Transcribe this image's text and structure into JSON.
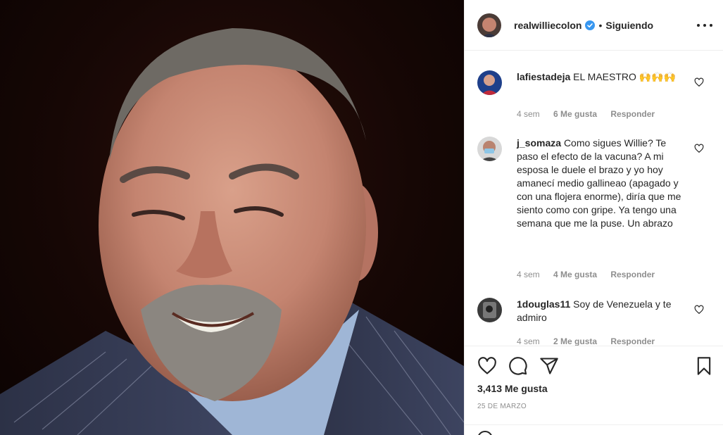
{
  "post": {
    "username": "realwilliecolon",
    "separator": "•",
    "follow_status": "Siguiendo"
  },
  "comments": [
    {
      "user": "lafiestadeja",
      "text": "EL MAESTRO 🙌🙌🙌",
      "time": "4 sem",
      "likes": "6 Me gusta",
      "reply": "Responder"
    },
    {
      "user": "j_somaza",
      "text": "Como sigues Willie? Te paso el efecto de la vacuna? A mi esposa le duele el brazo y yo hoy amanecí medio gallineao (apagado y con una flojera enorme), diría que me siento como con gripe. Ya tengo una semana que me la puse. Un abrazo",
      "time": "4 sem",
      "likes": "4 Me gusta",
      "reply": "Responder"
    },
    {
      "user": "1douglas11",
      "text": "Soy de Venezuela y te admiro",
      "time": "4 sem",
      "likes": "2 Me gusta",
      "reply": "Responder"
    }
  ],
  "footer": {
    "likes": "3,413 Me gusta",
    "date": "25 DE MARZO"
  },
  "icons": [
    "heart-icon",
    "comment-icon",
    "share-icon",
    "bookmark-icon",
    "more-options-icon",
    "verified-badge-icon"
  ],
  "colors": {
    "verified": "#3897f0",
    "text": "#262626",
    "muted": "#8e8e8e",
    "border": "#efefef"
  }
}
